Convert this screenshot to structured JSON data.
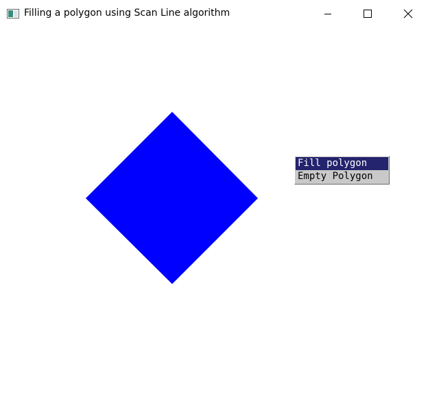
{
  "window": {
    "title": "Filling a polygon using Scan Line algorithm",
    "controls": {
      "minimize_icon": "minimize-icon",
      "maximize_icon": "maximize-icon",
      "close_icon": "close-icon"
    }
  },
  "canvas": {
    "polygon": {
      "shape": "diamond",
      "fill_color": "#0000ff",
      "state": "filled"
    }
  },
  "popup_menu": {
    "items": [
      {
        "label": "Fill polygon",
        "selected": true
      },
      {
        "label": "Empty Polygon",
        "selected": false
      }
    ],
    "selected_bg": "#23236e",
    "bg": "#c9c9c9"
  }
}
